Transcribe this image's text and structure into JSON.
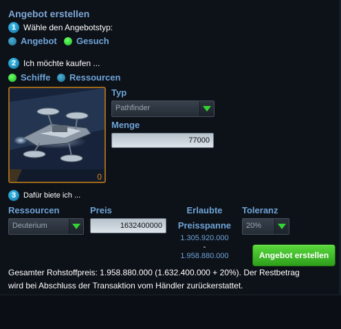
{
  "title": "Angebot erstellen",
  "step1": {
    "number": "1",
    "label": "Wähle den Angebotstyp:",
    "options": [
      "Angebot",
      "Gesuch"
    ],
    "selected": "Gesuch"
  },
  "step2": {
    "number": "2",
    "label": "Ich möchte kaufen ...",
    "options": [
      "Schiffe",
      "Ressourcen"
    ],
    "selected": "Schiffe",
    "item_count": "0",
    "typ_label": "Typ",
    "typ_value": "Pathfinder",
    "menge_label": "Menge",
    "menge_value": "77000"
  },
  "step3": {
    "number": "3",
    "label": "Dafür biete ich ...",
    "ressourcen_label": "Ressourcen",
    "ressourcen_value": "Deuterium",
    "preis_label": "Preis",
    "preis_value": "1632400000",
    "erlaubte_label": "Erlaubte",
    "preisspanne_label": "Preisspanne",
    "range_min": "1.305.920.000",
    "range_sep": "-",
    "range_max": "1.958.880.000",
    "toleranz_label": "Toleranz",
    "toleranz_value": "20%"
  },
  "submit_label": "Angebot erstellen",
  "summary_line1": "Gesamter Rohstoffpreis: 1.958.880.000 (1.632.400.000 + 20%). Der Restbetrag",
  "summary_line2": "wird bei Abschluss der Transaktion vom Händler zurückerstattet.",
  "colors": {
    "accent_blue": "#6fa4d7",
    "button_green": "#3fb526",
    "radio_green": "#2ecc2e",
    "frame_orange": "#a06a1a"
  },
  "icons": {
    "dropdown_arrow": "green-triangle-down",
    "ship_image": "pathfinder-ship"
  }
}
